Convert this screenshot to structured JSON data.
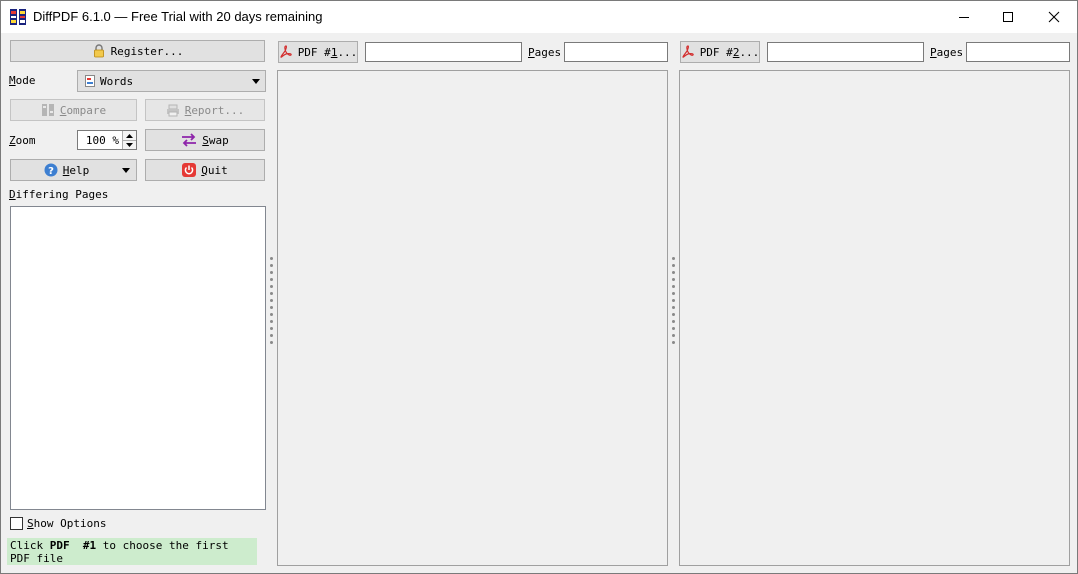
{
  "window": {
    "title": "DiffPDF 6.1.0 — Free Trial with 20 days remaining"
  },
  "left_panel": {
    "register_button": {
      "pre": "Re",
      "key": "g",
      "post": "ister..."
    },
    "mode": {
      "label_key": "M",
      "label_rest": "ode",
      "selected": "Words"
    },
    "compare_button": {
      "key": "C",
      "rest": "ompare"
    },
    "report_button": {
      "key": "R",
      "rest": "eport..."
    },
    "zoom": {
      "label_key": "Z",
      "label_rest": "oom",
      "value": "100 %"
    },
    "swap_button": {
      "key": "S",
      "rest": "wap"
    },
    "help_button": {
      "key": "H",
      "rest": "elp"
    },
    "quit_button": {
      "key": "Q",
      "rest": "uit"
    },
    "differing_pages": {
      "label_key": "D",
      "label_rest": "iffering Pages"
    },
    "show_options": {
      "key": "S",
      "rest": "how Options",
      "checked": false
    },
    "status": {
      "pre": "Click ",
      "pdf": "PDF",
      "num": "#1",
      "post": " to choose the first PDF file"
    }
  },
  "pdf1": {
    "button": {
      "pre": "PDF #",
      "key": "1",
      "post": "..."
    },
    "pages_label": {
      "key": "P",
      "rest": "ages"
    },
    "file_value": "",
    "pages_value": ""
  },
  "pdf2": {
    "button": {
      "pre": "PDF #",
      "key": "2",
      "post": "..."
    },
    "pages_label": {
      "key": "P",
      "rest": "ages"
    },
    "file_value": "",
    "pages_value": ""
  },
  "colors": {
    "status_bg": "#cdeccd",
    "pdf_red": "#d32f2f",
    "quit_red": "#e53935",
    "help_blue": "#3d7fd1",
    "swap_purple": "#8e24aa"
  }
}
